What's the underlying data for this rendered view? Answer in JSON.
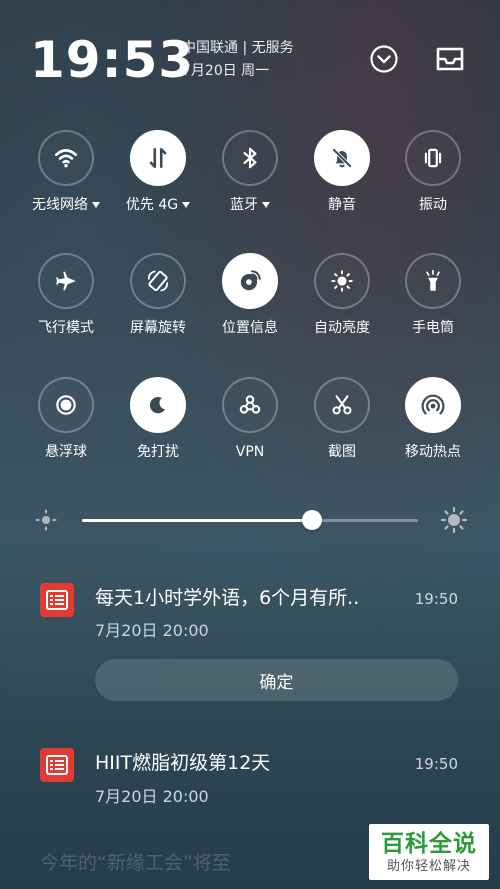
{
  "header": {
    "time": "19:53",
    "carrier": "中国联通 | 无服务",
    "date": "7月20日 周一",
    "expand_icon": "chevron-down-circle-icon",
    "tray_icon": "inbox-tray-icon"
  },
  "tiles": [
    {
      "label": "无线网络",
      "icon": "wifi-icon",
      "on": false,
      "dropdown": true
    },
    {
      "label": "优先 4G",
      "icon": "data-arrows-icon",
      "on": true,
      "dropdown": true
    },
    {
      "label": "蓝牙",
      "icon": "bluetooth-icon",
      "on": false,
      "dropdown": true
    },
    {
      "label": "静音",
      "icon": "bell-off-icon",
      "on": true,
      "dropdown": false
    },
    {
      "label": "振动",
      "icon": "vibrate-icon",
      "on": false,
      "dropdown": false
    },
    {
      "label": "飞行模式",
      "icon": "airplane-icon",
      "on": false,
      "dropdown": false
    },
    {
      "label": "屏幕旋转",
      "icon": "rotate-screen-icon",
      "on": false,
      "dropdown": false
    },
    {
      "label": "位置信息",
      "icon": "location-icon",
      "on": true,
      "dropdown": false
    },
    {
      "label": "自动亮度",
      "icon": "auto-brightness-icon",
      "on": false,
      "dropdown": false
    },
    {
      "label": "手电筒",
      "icon": "flashlight-icon",
      "on": false,
      "dropdown": false
    },
    {
      "label": "悬浮球",
      "icon": "float-ball-icon",
      "on": false,
      "dropdown": false
    },
    {
      "label": "免打扰",
      "icon": "moon-icon",
      "on": true,
      "dropdown": false
    },
    {
      "label": "VPN",
      "icon": "vpn-icon",
      "on": false,
      "dropdown": false
    },
    {
      "label": "截图",
      "icon": "scissors-icon",
      "on": false,
      "dropdown": false
    },
    {
      "label": "移动热点",
      "icon": "hotspot-icon",
      "on": true,
      "dropdown": false
    }
  ],
  "brightness": {
    "level": 0.685,
    "low_icon": "brightness-low-icon",
    "high_icon": "brightness-high-icon"
  },
  "notifications": [
    {
      "title": "每天1小时学外语，6个月有所..",
      "time": "19:50",
      "subtitle": "7月20日 20:00",
      "action": "确定",
      "icon": "calendar-list-icon"
    },
    {
      "title": "HIIT燃脂初级第12天",
      "time": "19:50",
      "subtitle": "7月20日 20:00",
      "icon": "calendar-list-icon"
    }
  ],
  "faded_notification": "今年的“新缘工会”将至",
  "watermark": {
    "title": "百科全说",
    "subtitle": "助你轻松解决"
  },
  "colors": {
    "active_tile": "#ffffff",
    "app_icon": "#e23b33",
    "watermark_green": "#2d9b3a"
  }
}
